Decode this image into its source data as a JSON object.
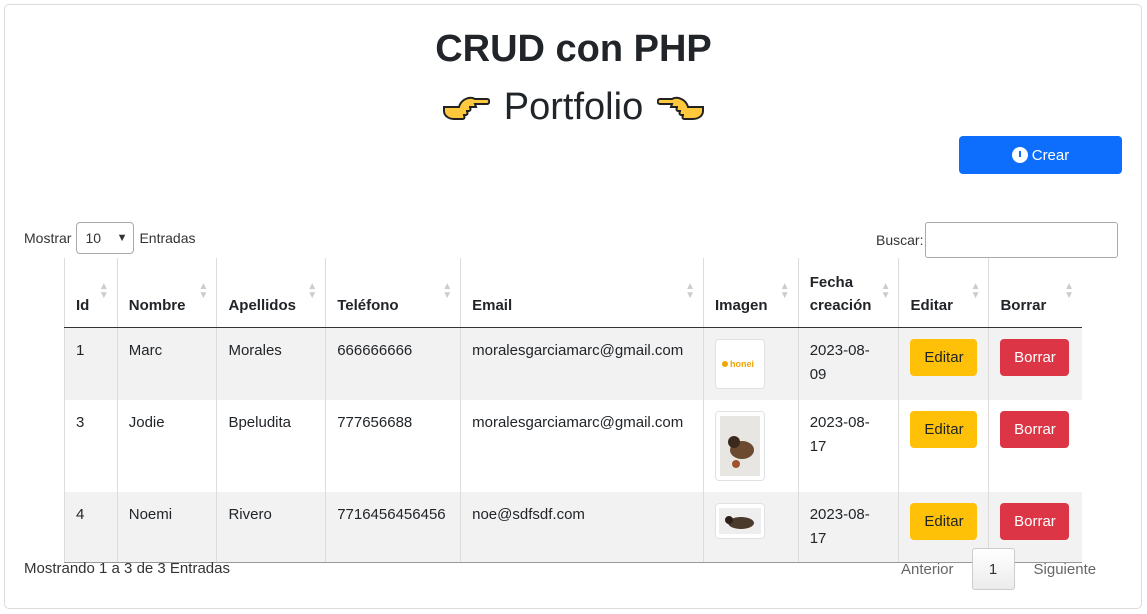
{
  "header": {
    "title": "CRUD con PHP",
    "subtitle": "Portfolio"
  },
  "toolbar": {
    "create_label": "Crear"
  },
  "length": {
    "prefix": "Mostrar",
    "value": "10",
    "suffix": "Entradas"
  },
  "search": {
    "label": "Buscar:",
    "value": ""
  },
  "table": {
    "columns": [
      "Id",
      "Nombre",
      "Apellidos",
      "Teléfono",
      "Email",
      "Imagen",
      "Fecha creación",
      "Editar",
      "Borrar"
    ],
    "rows": [
      {
        "id": "1",
        "nombre": "Marc",
        "apellidos": "Morales",
        "telefono": "666666666",
        "email": "moralesgarciamarc@gmail.com",
        "image_text": "honei",
        "fecha_a": "2023-08-",
        "fecha_b": "09",
        "edit": "Editar",
        "delete": "Borrar"
      },
      {
        "id": "3",
        "nombre": "Jodie",
        "apellidos": "Bpeludita",
        "telefono": "777656688",
        "email": "moralesgarciamarc@gmail.com",
        "fecha_a": "2023-08-",
        "fecha_b": "17",
        "edit": "Editar",
        "delete": "Borrar"
      },
      {
        "id": "4",
        "nombre": "Noemi",
        "apellidos": "Rivero",
        "telefono": "7716456456456",
        "email": "noe@sdfsdf.com",
        "fecha_a": "2023-08-",
        "fecha_b": "17",
        "edit": "Editar",
        "delete": "Borrar"
      }
    ]
  },
  "footer": {
    "info": "Mostrando 1 a 3 de 3 Entradas",
    "prev": "Anterior",
    "page": "1",
    "next": "Siguiente"
  },
  "colors": {
    "primary": "#0d6efd",
    "warning": "#ffc107",
    "danger": "#dc3545"
  },
  "icons": {
    "left_hand": "pointing-right-hand-icon",
    "right_hand": "pointing-left-hand-icon",
    "create": "info-circle-icon",
    "sort": "sort-arrows-icon",
    "select": "chevron-down-icon"
  }
}
